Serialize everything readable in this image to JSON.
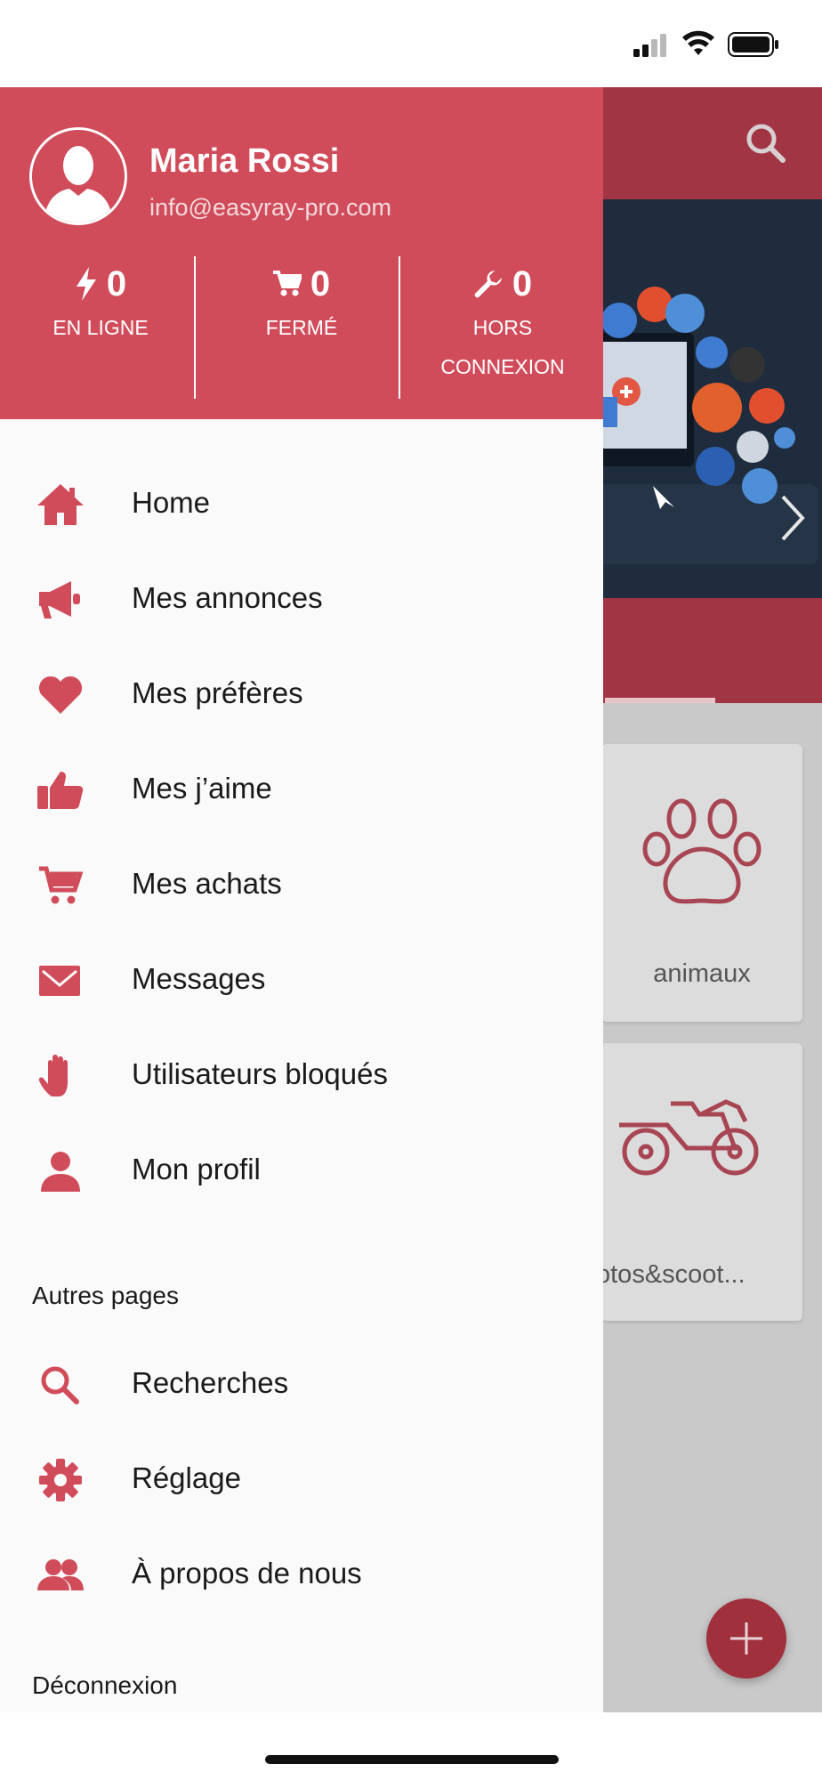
{
  "status_bar": {
    "signal_icon": "cellular-signal-icon",
    "wifi_icon": "wifi-icon",
    "battery_icon": "battery-icon"
  },
  "profile": {
    "name": "Maria Rossi",
    "email": "info@easyray-pro.com",
    "avatar_icon": "person-silhouette-icon",
    "stats": [
      {
        "icon": "bolt-icon",
        "value": "0",
        "label": "EN LIGNE"
      },
      {
        "icon": "cart-icon",
        "value": "0",
        "label": "FERMÉ"
      },
      {
        "icon": "wrench-icon",
        "value": "0",
        "label_line1": "HORS",
        "label_line2": "CONNEXION"
      }
    ]
  },
  "menu": [
    {
      "icon": "home-icon",
      "label": "Home"
    },
    {
      "icon": "megaphone-icon",
      "label": "Mes annonces"
    },
    {
      "icon": "heart-icon",
      "label": "Mes préfères"
    },
    {
      "icon": "thumbs-up-icon",
      "label": "Mes j’aime"
    },
    {
      "icon": "cart-icon",
      "label": "Mes achats"
    },
    {
      "icon": "envelope-icon",
      "label": "Messages"
    },
    {
      "icon": "hand-stop-icon",
      "label": "Utilisateurs bloqués"
    },
    {
      "icon": "user-icon",
      "label": "Mon profil"
    }
  ],
  "other_pages": {
    "title": "Autres pages",
    "items": [
      {
        "icon": "search-icon",
        "label": "Recherches"
      },
      {
        "icon": "gear-icon",
        "label": "Réglage"
      },
      {
        "icon": "users-icon",
        "label": "À propos de nous"
      }
    ]
  },
  "logout": {
    "label": "Déconnexion"
  },
  "background": {
    "categories": [
      {
        "icon": "paw-icon",
        "label": "animaux"
      },
      {
        "icon": "motorcycle-icon",
        "label": "otos&scoot..."
      }
    ],
    "fab_icon": "plus-icon"
  },
  "colors": {
    "accent": "#d14c5b",
    "accent_dark": "#a13544",
    "drawer_bg": "#fafafa"
  }
}
